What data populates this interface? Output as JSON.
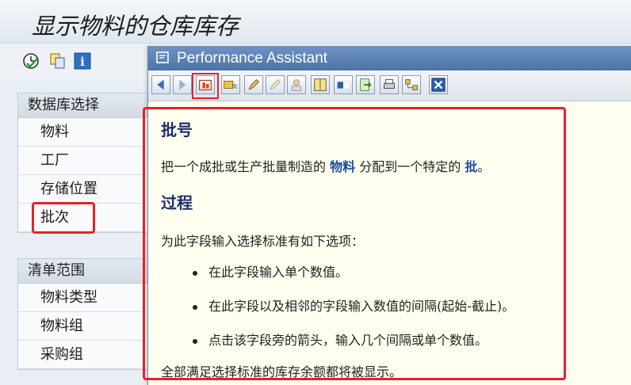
{
  "window": {
    "title": "显示物料的仓库库存"
  },
  "toolbar": {
    "icons": [
      "execute-clock-icon",
      "copy-variant-icon",
      "info-icon"
    ]
  },
  "selection_group": {
    "header": "数据库选择",
    "items": [
      "物料",
      "工厂",
      "存储位置",
      "批次"
    ]
  },
  "list_group": {
    "header": "清单范围",
    "items": [
      "物料类型",
      "物料组",
      "采购组"
    ]
  },
  "popup": {
    "title": "Performance Assistant",
    "toolbar_icons": [
      "back-icon",
      "forward-icon",
      "technical-info-icon",
      "field-info-icon",
      "edit-icon",
      "edit-disabled-icon",
      "user-icon",
      "document-icon",
      "toggle-icon",
      "export-icon",
      "print-icon",
      "network-icon",
      "close-icon"
    ],
    "heading1": "批号",
    "para1": {
      "before": "把一个成批或生产批量制造的",
      "kw1": "物料",
      "middle": "分配到一个特定的",
      "kw2": "批",
      "after": "。"
    },
    "heading2": "过程",
    "para2": "为此字段输入选择标准有如下选项：",
    "bullets": [
      "在此字段输入单个数值。",
      "在此字段以及相邻的字段输入数值的间隔(起始-截止)。",
      "点击该字段旁的箭头，输入几个间隔或单个数值。"
    ],
    "para3": "全部满足选择标准的库存余额都将被显示。"
  }
}
